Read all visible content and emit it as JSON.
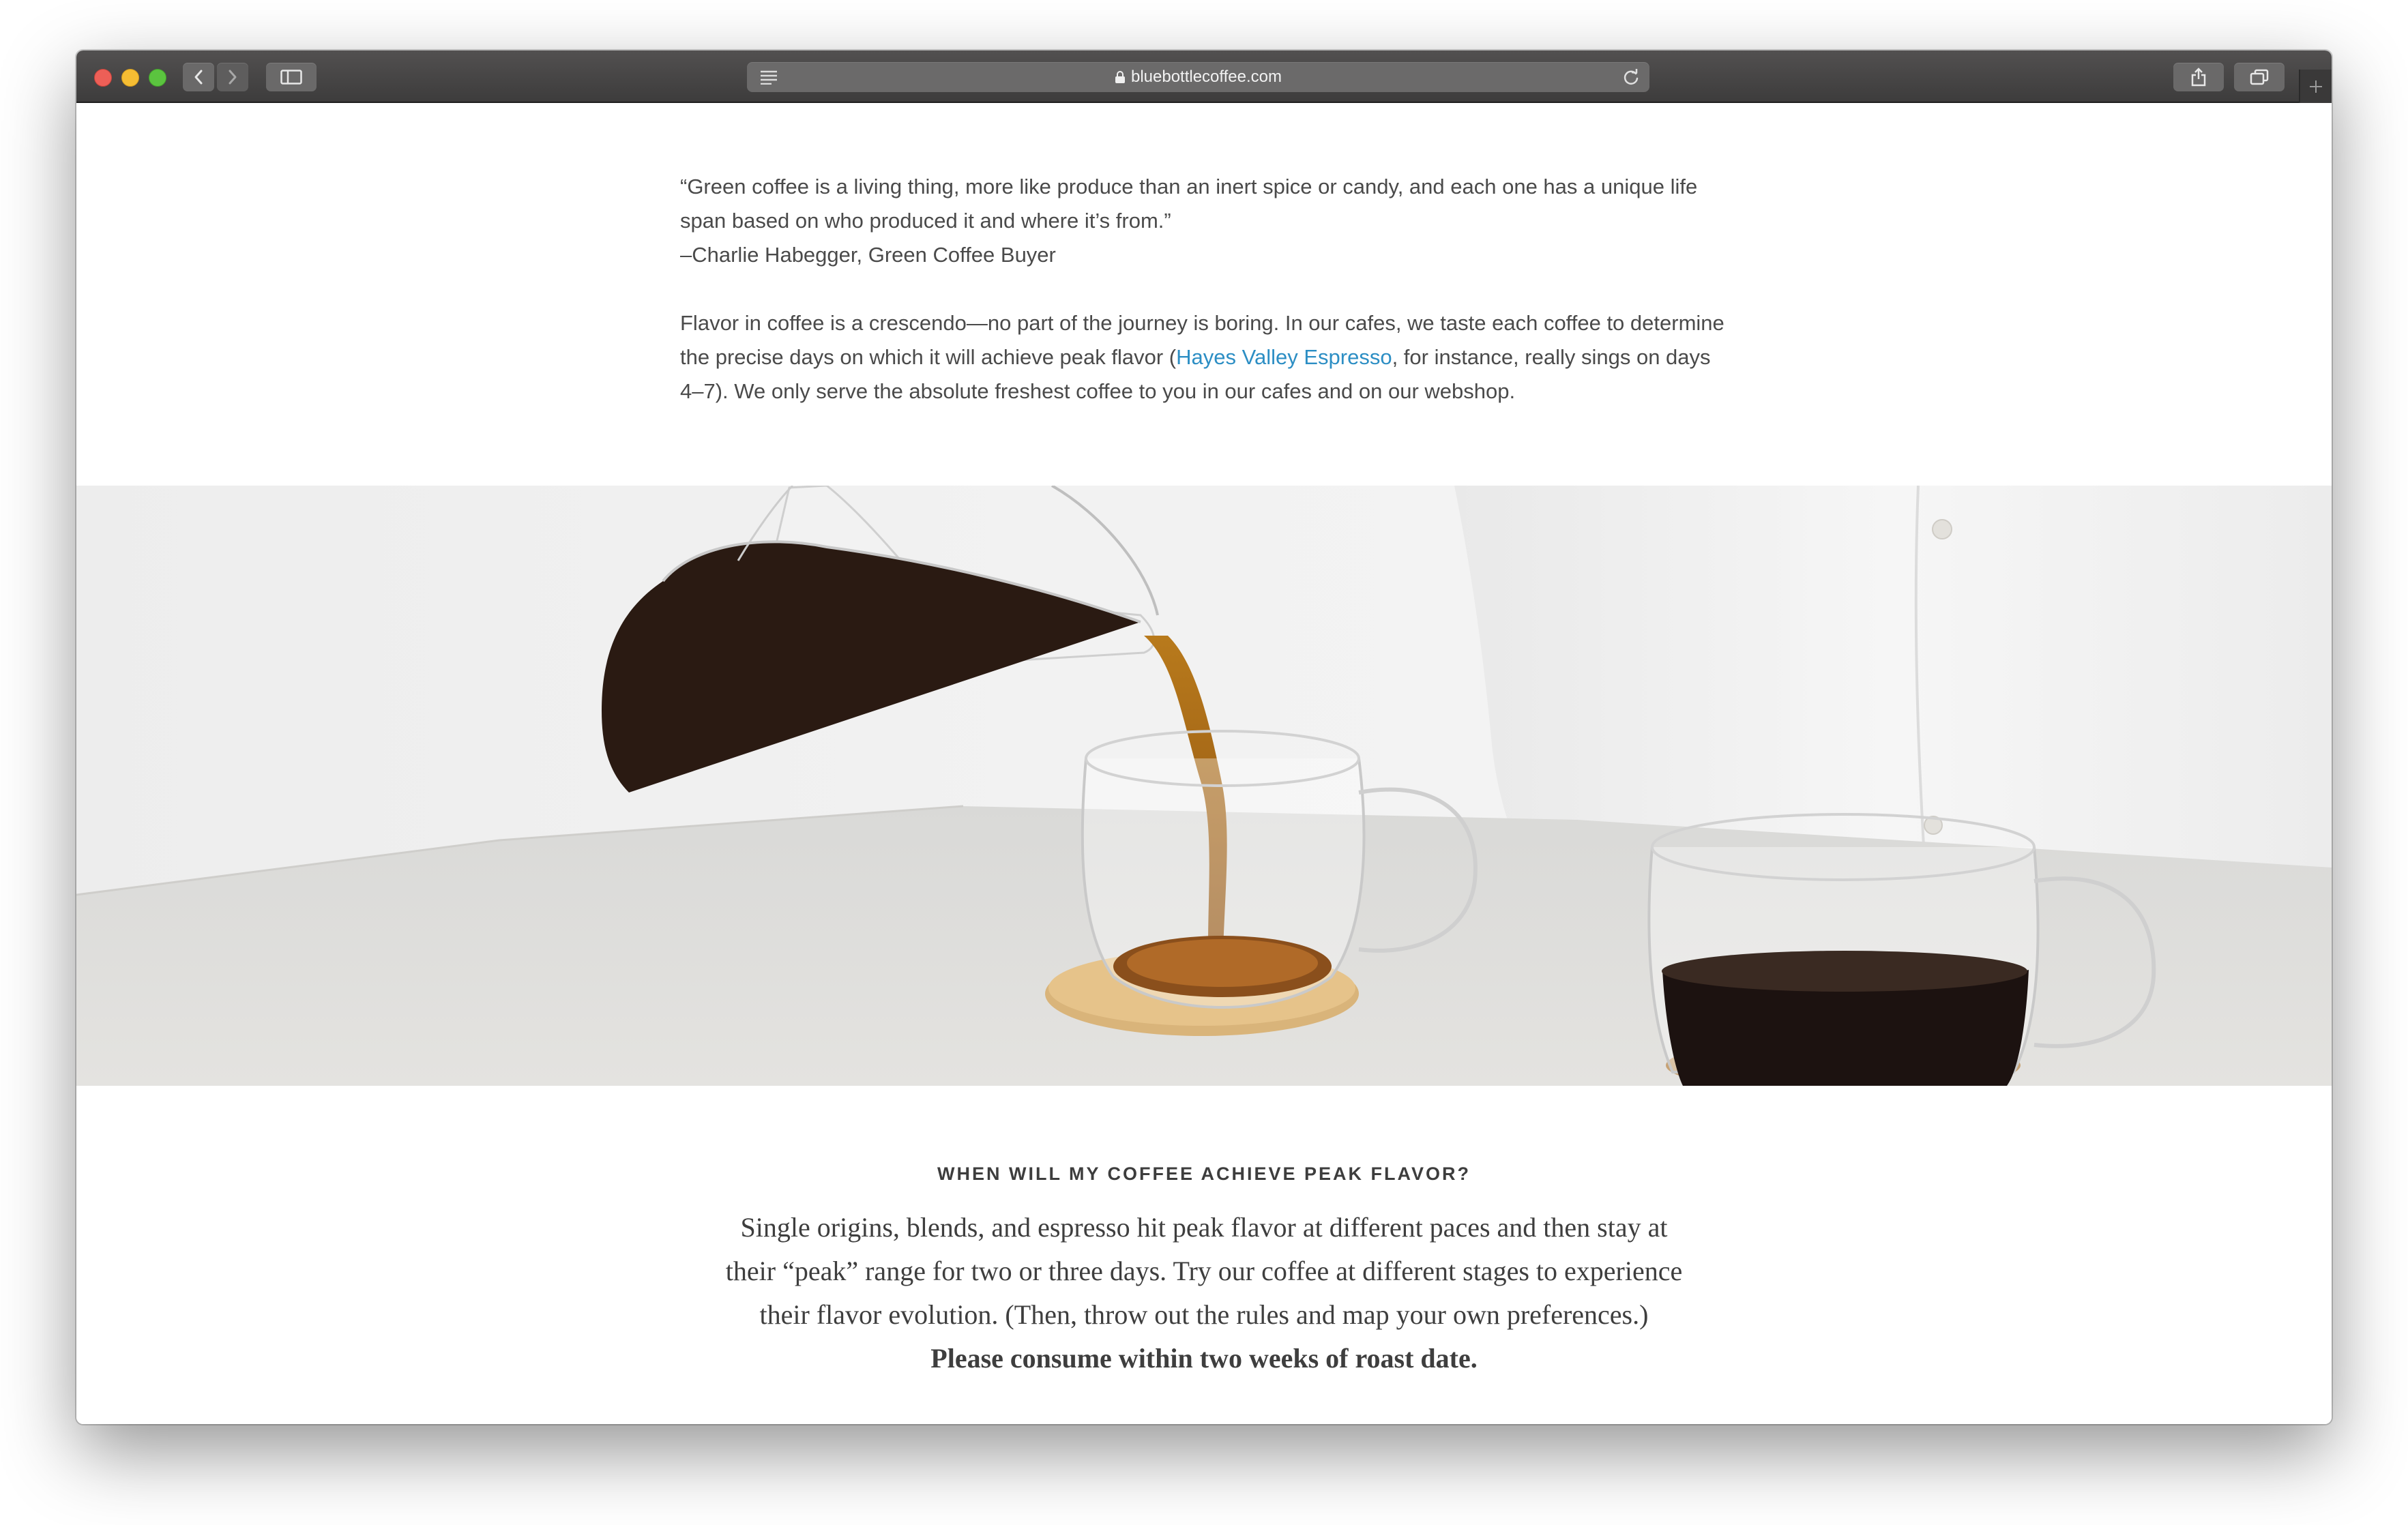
{
  "browser": {
    "url": "bluebottlecoffee.com",
    "icons": {
      "back": "chevron-left-icon",
      "forward": "chevron-right-icon",
      "sidebar": "sidebar-icon",
      "reader": "reader-icon",
      "lock": "lock-icon",
      "reload": "reload-icon",
      "share": "share-icon",
      "tabs": "tabs-icon",
      "new_tab": "plus-icon"
    },
    "colors": {
      "close": "#ed5f57",
      "minimize": "#f5bd33",
      "maximize": "#5bc43f"
    }
  },
  "article": {
    "quote": "“Green coffee is a living thing, more like produce than an inert spice or candy, and each one has a unique life span based on who produced it and where it’s from.”",
    "attribution": "–Charlie Habegger, Green Coffee Buyer",
    "flavor_before": "Flavor in coffee is a crescendo—no part of the journey is boring. In our cafes, we taste each coffee to determine the precise days on which it will achieve peak flavor (",
    "flavor_link": "Hayes Valley Espresso",
    "flavor_after": ", for instance, really sings on days 4–7). We only serve the absolute freshest coffee to you in our cafes and on our webshop.",
    "link_color": "#2c8ec4"
  },
  "peak_section": {
    "heading": "WHEN WILL MY COFFEE ACHIEVE PEAK FLAVOR?",
    "line1": "Single origins, blends, and espresso hit peak flavor at different paces and then stay at",
    "line2": "their “peak” range for two or three days. Try our coffee at different stages to experience",
    "line3": "their flavor evolution. (Then, throw out the rules and map your own preferences.)",
    "bold_line": "Please consume within two weeks of roast date."
  }
}
